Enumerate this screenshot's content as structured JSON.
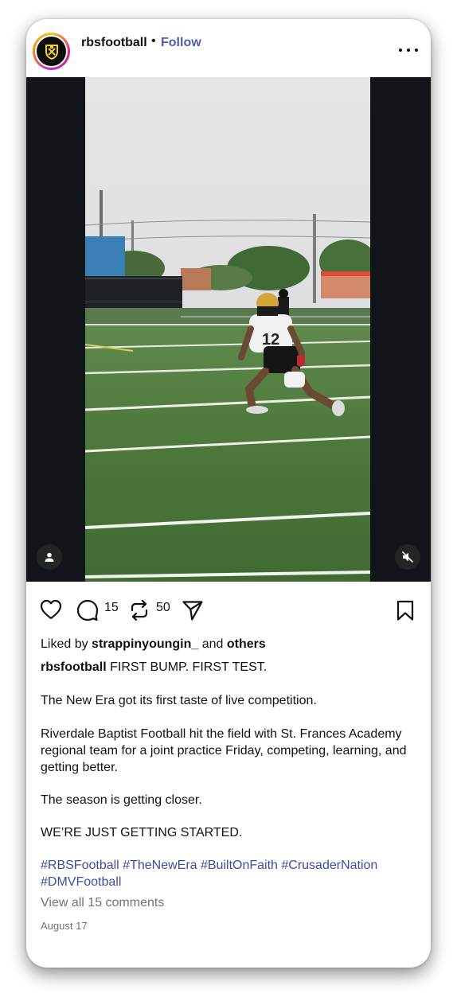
{
  "post": {
    "username": "rbsfootball",
    "separator": "•",
    "follow_label": "Follow",
    "more_icon": "more-horizontal-icon",
    "media": {
      "user_tag_icon": "person-icon",
      "mute_icon": "speaker-muted-icon",
      "jersey_number": "12"
    },
    "actions": {
      "like_icon": "heart-icon",
      "comment_icon": "comment-bubble-icon",
      "comment_count": "15",
      "repost_icon": "repost-icon",
      "repost_count": "50",
      "share_icon": "paper-plane-icon",
      "save_icon": "bookmark-icon"
    },
    "likes": {
      "prefix": "Liked by",
      "user": "strappinyoungin_",
      "middle": "and",
      "others": "others"
    },
    "caption": {
      "author": "rbsfootball",
      "line1": "FIRST BUMP. FIRST TEST.",
      "line2": "The New Era got its first taste of live competition.",
      "line3": "Riverdale Baptist Football hit the field with St. Frances Academy regional team for a joint practice Friday, competing, learning, and getting better.",
      "line4": "The season is getting closer.",
      "line5": "WE’RE JUST GETTING STARTED.",
      "hashtags": "#RBSFootball #TheNewEra #BuiltOnFaith #CrusaderNation #DMVFootball"
    },
    "view_comments": "View all 15 comments",
    "date": "August 17"
  }
}
